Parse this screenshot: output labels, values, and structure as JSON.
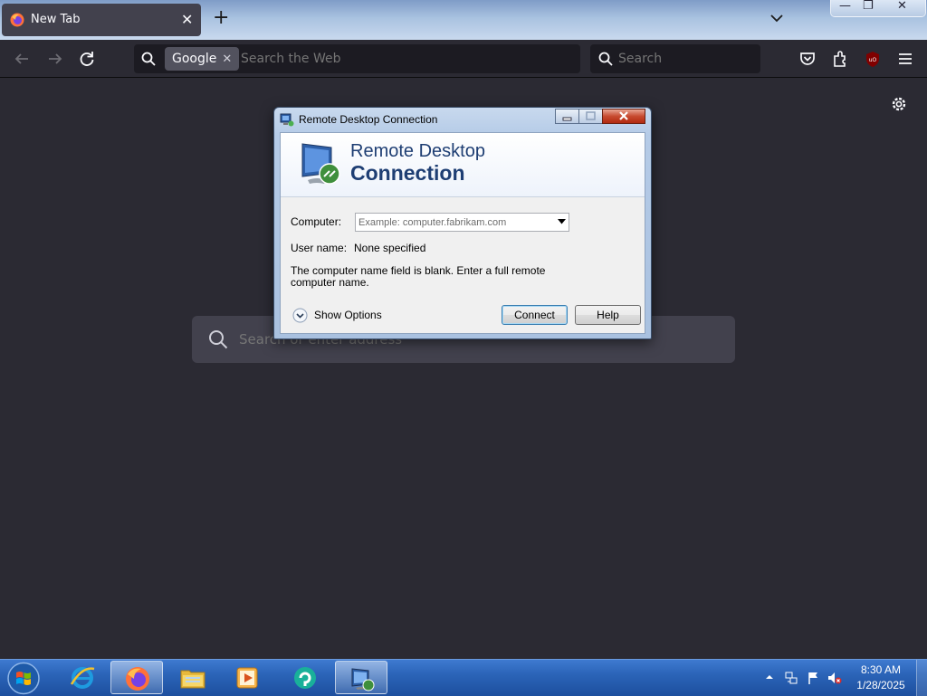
{
  "browser": {
    "tab": {
      "title": "New Tab",
      "icon": "firefox-icon",
      "close_label": "✕"
    },
    "new_tab_label": "+",
    "window_controls": {
      "minimize": "—",
      "restore": "❐",
      "close": "✕"
    },
    "urlbar": {
      "engine": "Google",
      "engine_clear": "✕",
      "placeholder": "Search the Web"
    },
    "searchbar": {
      "placeholder": "Search"
    },
    "toolbar_icons": [
      "back-icon",
      "forward-icon",
      "reload-icon",
      "pocket-icon",
      "extensions-icon",
      "ublock-origin-icon",
      "menu-icon"
    ],
    "newtab_search": {
      "placeholder": "Search or enter address"
    }
  },
  "dialog": {
    "title": "Remote Desktop Connection",
    "banner_line1": "Remote Desktop",
    "banner_line2": "Connection",
    "computer_label": "Computer:",
    "computer_placeholder": "Example: computer.fabrikam.com",
    "username_label": "User name:",
    "username_value": "None specified",
    "message": "The computer name field is blank. Enter a full remote computer name.",
    "show_options": "Show Options",
    "connect": "Connect",
    "help": "Help"
  },
  "taskbar": {
    "pinned": [
      "internet-explorer-icon",
      "firefox-icon",
      "file-explorer-icon",
      "media-player-icon",
      "remote-app-icon",
      "remote-desktop-icon"
    ],
    "clock_time": "8:30 AM",
    "clock_date": "1/28/2025"
  },
  "colors": {
    "browser_bg": "#2b2a33",
    "toolbar_field": "#1c1b22",
    "dialog_heading": "#1e3e73",
    "taskbar": "#2b64b8"
  }
}
